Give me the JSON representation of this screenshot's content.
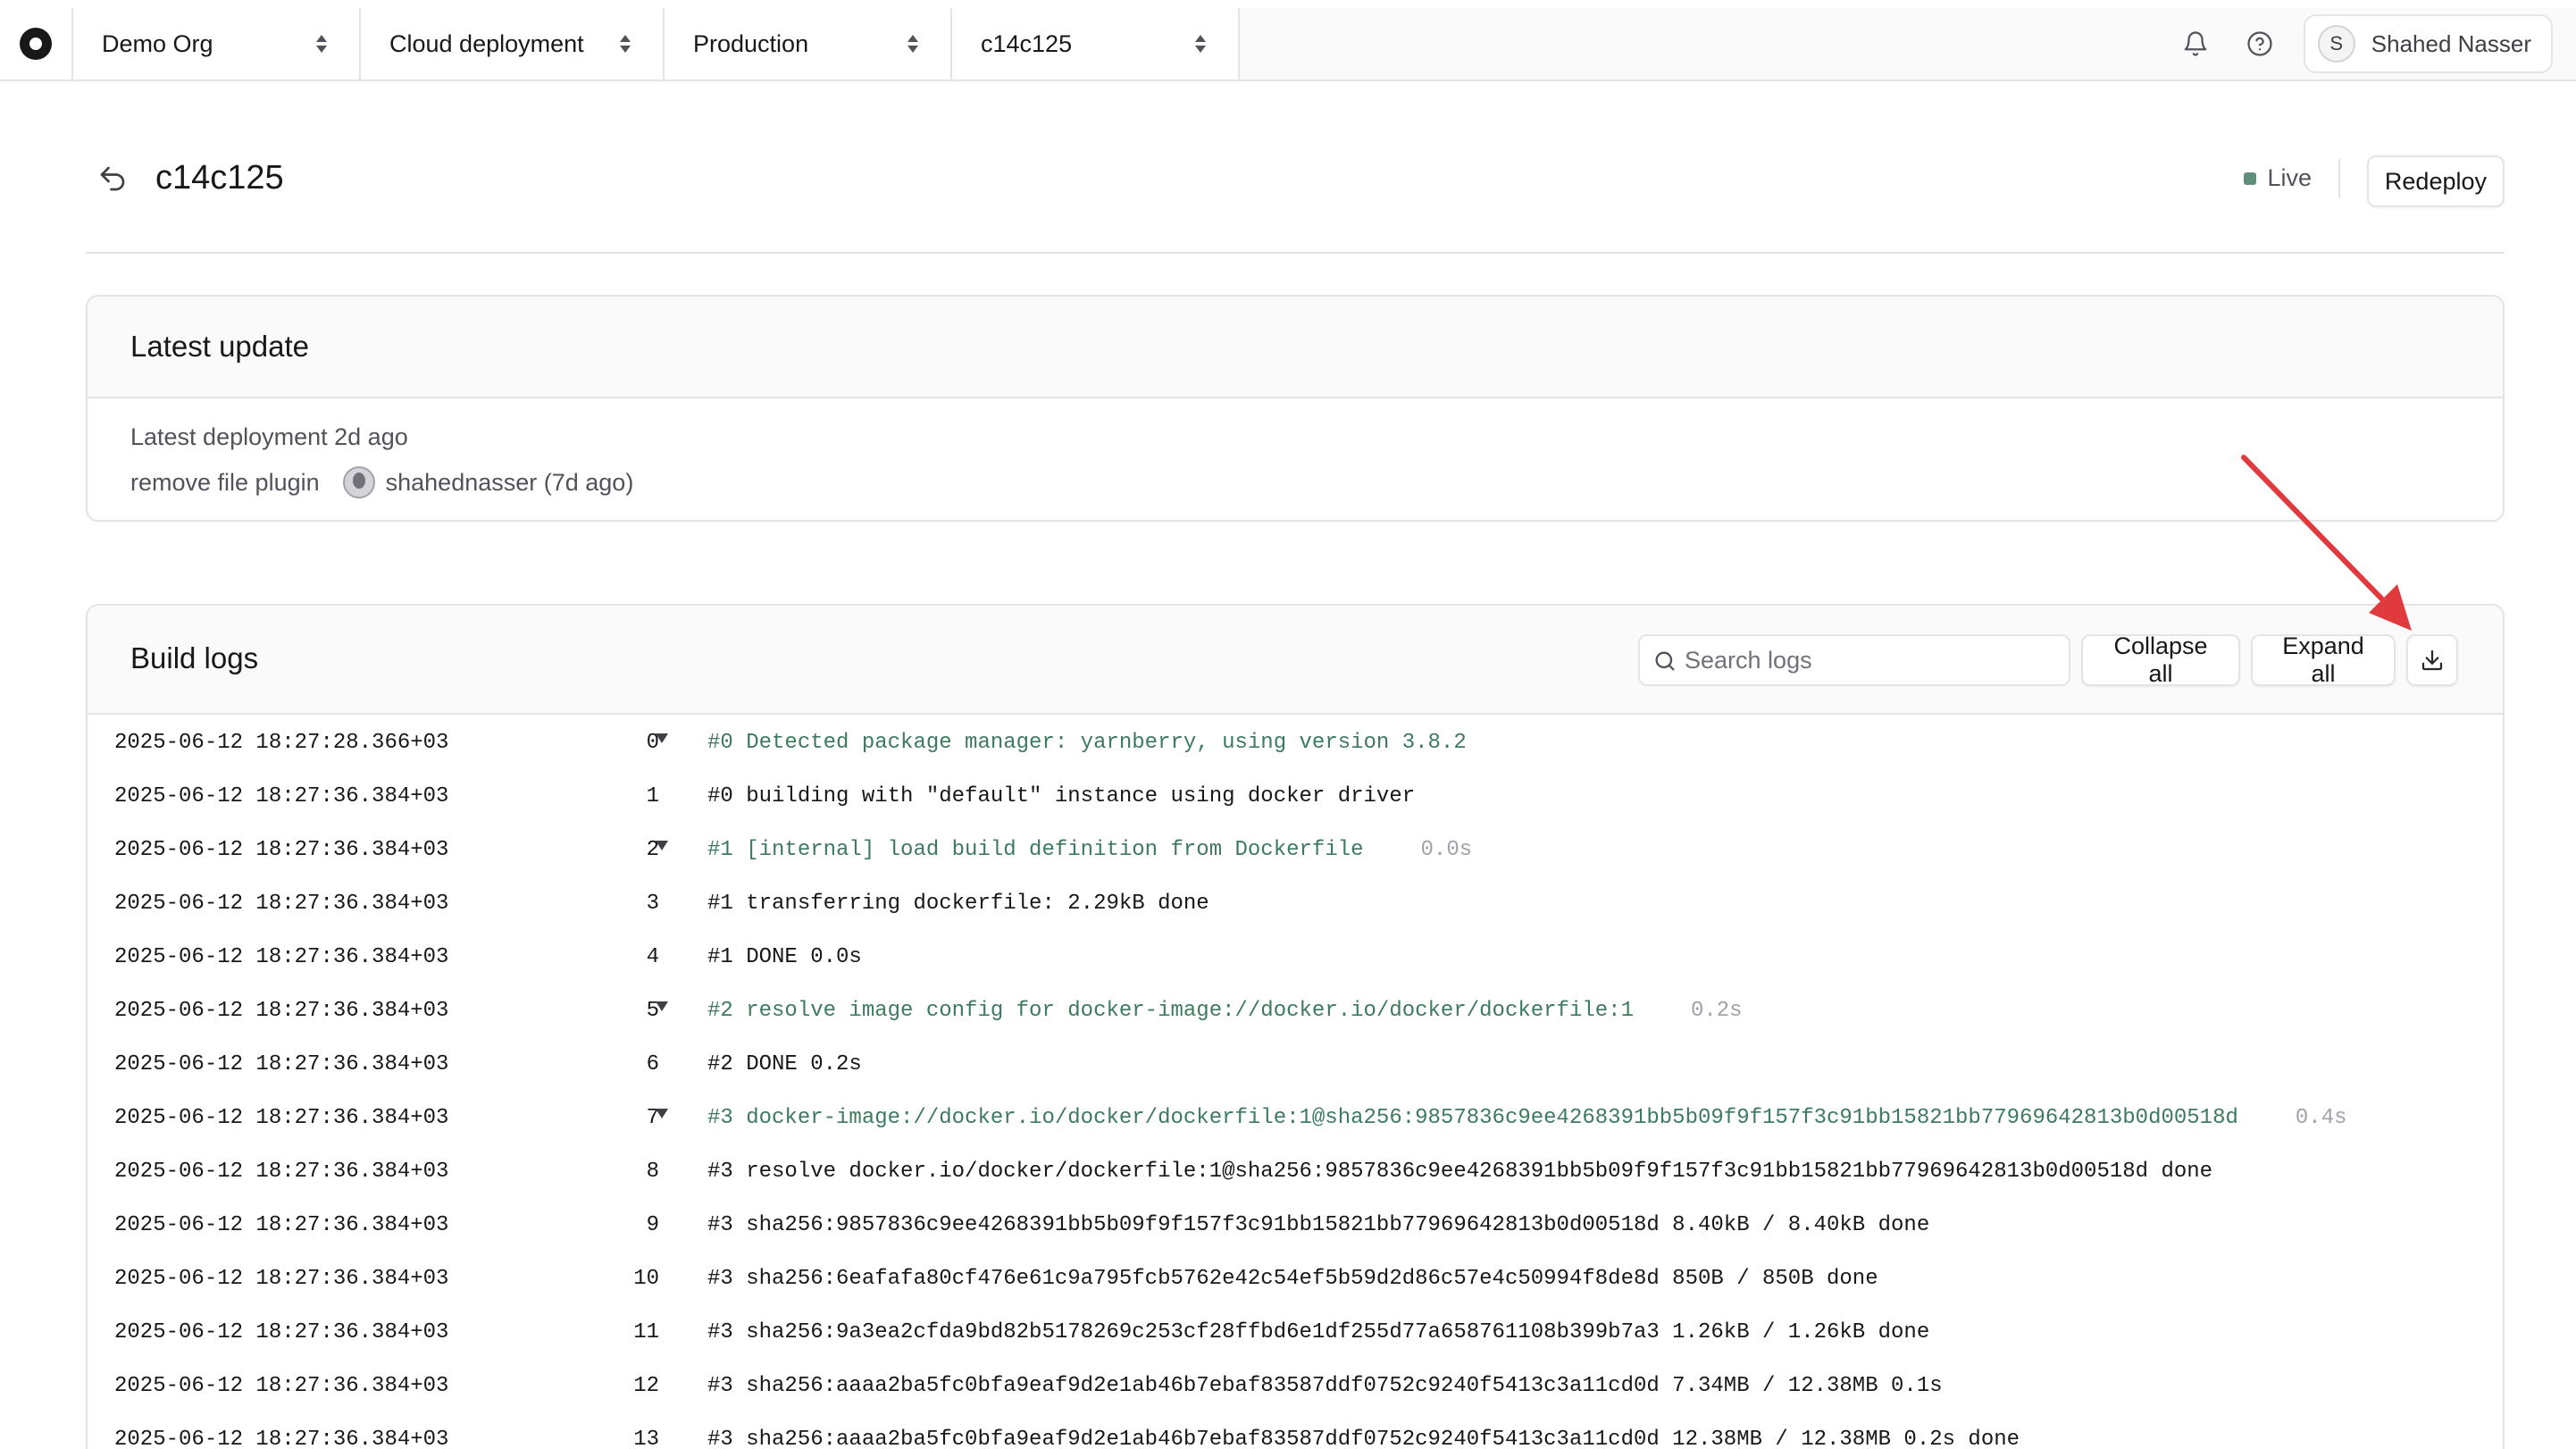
{
  "topbar": {
    "crumbs": [
      {
        "label": "Demo Org"
      },
      {
        "label": "Cloud deployment"
      },
      {
        "label": "Production"
      },
      {
        "label": "c14c125"
      }
    ],
    "user": {
      "initial": "S",
      "name": "Shahed Nasser"
    }
  },
  "page": {
    "title": "c14c125",
    "status": "Live",
    "redeploy_label": "Redeploy",
    "colors": {
      "live": "#5f8f7d",
      "group_text": "#3e7a5f",
      "annotation_arrow": "#e0393e"
    }
  },
  "latest_update": {
    "title": "Latest update",
    "deployment_text": "Latest deployment 2d ago",
    "commit_message": "remove file plugin",
    "commit_author": "shahednasser (7d ago)"
  },
  "build_logs": {
    "title": "Build logs",
    "search_placeholder": "Search logs",
    "collapse_label": "Collapse all",
    "expand_label": "Expand all",
    "download_icon": "download-icon",
    "rows": [
      {
        "ts": "2025-06-12 18:27:28.366+03",
        "ln": "0",
        "group": true,
        "msg": "#0 Detected package manager: yarnberry, using version 3.8.2",
        "dur": ""
      },
      {
        "ts": "2025-06-12 18:27:36.384+03",
        "ln": "1",
        "group": false,
        "msg": "#0 building with \"default\" instance using docker driver",
        "dur": ""
      },
      {
        "ts": "2025-06-12 18:27:36.384+03",
        "ln": "2",
        "group": true,
        "msg": "#1 [internal] load build definition from Dockerfile",
        "dur": "0.0s"
      },
      {
        "ts": "2025-06-12 18:27:36.384+03",
        "ln": "3",
        "group": false,
        "msg": "#1 transferring dockerfile: 2.29kB done",
        "dur": ""
      },
      {
        "ts": "2025-06-12 18:27:36.384+03",
        "ln": "4",
        "group": false,
        "msg": "#1 DONE 0.0s",
        "dur": ""
      },
      {
        "ts": "2025-06-12 18:27:36.384+03",
        "ln": "5",
        "group": true,
        "msg": "#2 resolve image config for docker-image://docker.io/docker/dockerfile:1",
        "dur": "0.2s"
      },
      {
        "ts": "2025-06-12 18:27:36.384+03",
        "ln": "6",
        "group": false,
        "msg": "#2 DONE 0.2s",
        "dur": ""
      },
      {
        "ts": "2025-06-12 18:27:36.384+03",
        "ln": "7",
        "group": true,
        "msg": "#3 docker-image://docker.io/docker/dockerfile:1@sha256:9857836c9ee4268391bb5b09f9f157f3c91bb15821bb77969642813b0d00518d",
        "dur": "0.4s"
      },
      {
        "ts": "2025-06-12 18:27:36.384+03",
        "ln": "8",
        "group": false,
        "msg": "#3 resolve docker.io/docker/dockerfile:1@sha256:9857836c9ee4268391bb5b09f9f157f3c91bb15821bb77969642813b0d00518d done",
        "dur": ""
      },
      {
        "ts": "2025-06-12 18:27:36.384+03",
        "ln": "9",
        "group": false,
        "msg": "#3 sha256:9857836c9ee4268391bb5b09f9f157f3c91bb15821bb77969642813b0d00518d 8.40kB / 8.40kB done",
        "dur": ""
      },
      {
        "ts": "2025-06-12 18:27:36.384+03",
        "ln": "10",
        "group": false,
        "msg": "#3 sha256:6eafafa80cf476e61c9a795fcb5762e42c54ef5b59d2d86c57e4c50994f8de8d 850B / 850B done",
        "dur": ""
      },
      {
        "ts": "2025-06-12 18:27:36.384+03",
        "ln": "11",
        "group": false,
        "msg": "#3 sha256:9a3ea2cfda9bd82b5178269c253cf28ffbd6e1df255d77a658761108b399b7a3 1.26kB / 1.26kB done",
        "dur": ""
      },
      {
        "ts": "2025-06-12 18:27:36.384+03",
        "ln": "12",
        "group": false,
        "msg": "#3 sha256:aaaa2ba5fc0bfa9eaf9d2e1ab46b7ebaf83587ddf0752c9240f5413c3a11cd0d 7.34MB / 12.38MB 0.1s",
        "dur": ""
      },
      {
        "ts": "2025-06-12 18:27:36.384+03",
        "ln": "13",
        "group": false,
        "msg": "#3 sha256:aaaa2ba5fc0bfa9eaf9d2e1ab46b7ebaf83587ddf0752c9240f5413c3a11cd0d 12.38MB / 12.38MB 0.2s done",
        "dur": ""
      }
    ]
  }
}
